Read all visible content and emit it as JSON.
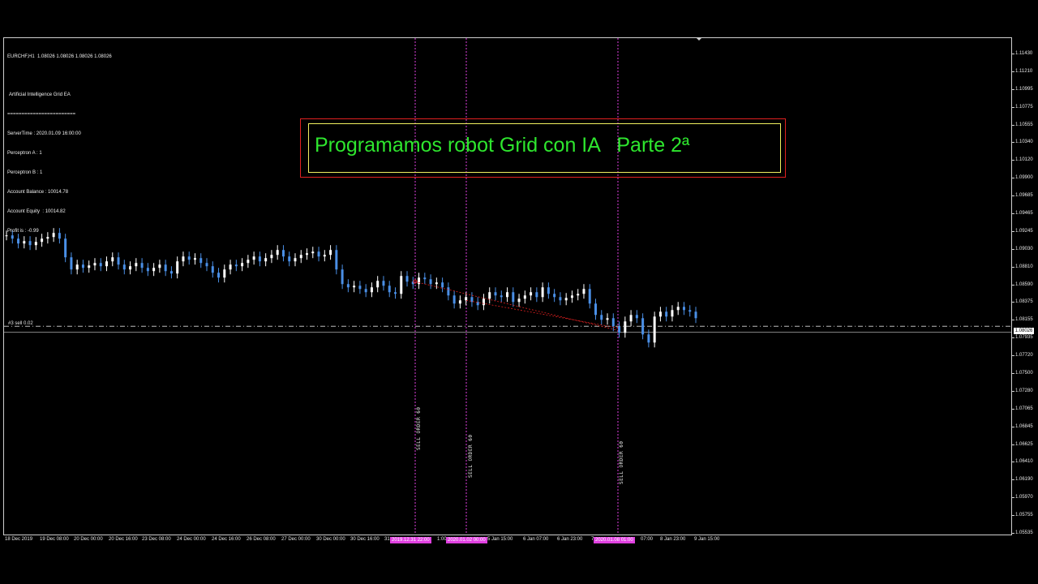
{
  "window": {
    "symbol_header": "EURCHF,H1  1.08026 1.08026 1.08026 1.08026"
  },
  "info_panel": {
    "ea_name": "Artificial Intelligence Grid EA",
    "separator": "========================",
    "lines": [
      "ServerTime : 2020.01.09 16:00:00",
      "Perceptron A : 1",
      "Perceptron B : 1",
      "Account Balance : 10014.78",
      "Account Equity  : 10014.82",
      "Profit is : -0.99"
    ]
  },
  "title_banner": {
    "text": "Programamos robot Grid con IA   Parte 2ª"
  },
  "trade": {
    "sell_label": "#3 sell 0.02",
    "current_price": "1.08026"
  },
  "order_markers": [
    {
      "label": "SELL ORDER  60"
    },
    {
      "label": "SELL ORDER  60"
    },
    {
      "label": "SELL ORDER  60"
    }
  ],
  "colors": {
    "title_text": "#2ee62e",
    "title_outer_border": "#e02020",
    "title_inner_border": "#f0f060",
    "vline": "#e040e0",
    "candle_up": "#ffffff",
    "candle_down": "#4a8fe6",
    "trendline": "#e02020"
  },
  "chart_data": {
    "type": "candlestick",
    "symbol": "EURCHF",
    "timeframe": "H1",
    "ylim": [
      1.05535,
      1.1165
    ],
    "y_ticks": [
      "1.11430",
      "1.11210",
      "1.10995",
      "1.10775",
      "1.10555",
      "1.10340",
      "1.10120",
      "1.09900",
      "1.09685",
      "1.09465",
      "1.09245",
      "1.09030",
      "1.08810",
      "1.08590",
      "1.08375",
      "1.08155",
      "1.07935",
      "1.07720",
      "1.07500",
      "1.07280",
      "1.07065",
      "1.06845",
      "1.06625",
      "1.06410",
      "1.06190",
      "1.05970",
      "1.05755",
      "1.05535"
    ],
    "x_ticks": [
      "18 Dec 2019",
      "19 Dec 08:00",
      "20 Dec 00:00",
      "20 Dec 16:00",
      "23 Dec 08:00",
      "24 Dec 00:00",
      "24 Dec 16:00",
      "26 Dec 08:00",
      "27 Dec 00:00",
      "30 Dec 00:00",
      "30 Dec 16:00",
      "31",
      "1:00",
      "5 Jan 15:00",
      "6 Jan 07:00",
      "6 Jan 23:00",
      "7",
      "07:00",
      "8 Jan 23:00",
      "9 Jan 15:00"
    ],
    "x_highlight_labels": [
      "2019.12.31 22:00",
      "2020.01.02 00:00",
      "2020.01.08 01:00"
    ],
    "close_path": [
      1.0922,
      1.0918,
      1.0912,
      1.0915,
      1.091,
      1.0914,
      1.0918,
      1.092,
      1.0925,
      1.0918,
      1.0895,
      1.088,
      1.0886,
      1.0882,
      1.0885,
      1.0888,
      1.0884,
      1.089,
      1.0895,
      1.0886,
      1.088,
      1.0884,
      1.0888,
      1.0882,
      1.0878,
      1.0882,
      1.0886,
      1.0878,
      1.0875,
      1.089,
      1.0896,
      1.0892,
      1.0894,
      1.0888,
      1.0884,
      1.0876,
      1.087,
      1.088,
      1.0886,
      1.0884,
      1.0888,
      1.0892,
      1.0896,
      1.089,
      1.0894,
      1.0898,
      1.0904,
      1.0896,
      1.089,
      1.0894,
      1.0898,
      1.09,
      1.0902,
      1.0896,
      1.0898,
      1.0904,
      1.088,
      1.0862,
      1.0858,
      1.086,
      1.0856,
      1.0852,
      1.0858,
      1.0866,
      1.086,
      1.0852,
      1.085,
      1.0872,
      1.0865,
      1.0862,
      1.087,
      1.0868,
      1.0862,
      1.0864,
      1.0858,
      1.0848,
      1.0838,
      1.0842,
      1.0846,
      1.084,
      1.0836,
      1.0844,
      1.0852,
      1.0848,
      1.0846,
      1.0852,
      1.084,
      1.0844,
      1.0848,
      1.0852,
      1.0846,
      1.0858,
      1.085,
      1.0846,
      1.0842,
      1.0845,
      1.0848,
      1.085,
      1.0856,
      1.0838,
      1.0824,
      1.0818,
      1.082,
      1.081,
      1.0802,
      1.0816,
      1.0824,
      1.082,
      1.08,
      1.079,
      1.0822,
      1.0828,
      1.0822,
      1.083,
      1.0834,
      1.083,
      1.0828,
      1.082
    ],
    "sell_line_price": 1.081,
    "current_price": 1.08026
  }
}
